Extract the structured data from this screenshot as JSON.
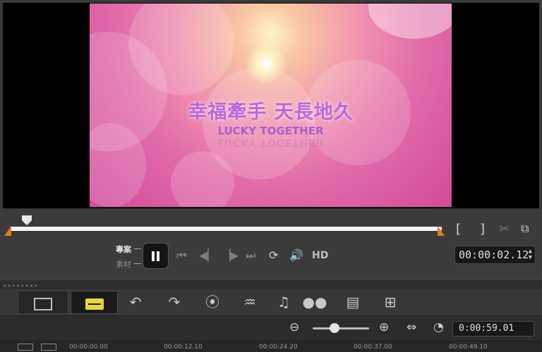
{
  "preview": {
    "title_zh": "幸福牽手 天長地久",
    "title_en": "LUCKY TOGETHER"
  },
  "playback": {
    "mode_project": "專案",
    "mode_clip": "素材",
    "hd_label": "HD",
    "timecode": "00:00:02.12"
  },
  "timeline": {
    "duration": "0:00:59.01",
    "ruler_ticks": [
      "00:00:00.00",
      "00:00:12.10",
      "00:00:24.20",
      "00:00:37.00",
      "00:00:49.10"
    ]
  },
  "icons": {
    "toolbar": [
      "storyboard-view-icon",
      "timeline-view-icon",
      "undo-icon",
      "redo-icon",
      "record-capture-icon",
      "sound-mixer-icon",
      "auto-music-icon",
      "motion-tracking-icon",
      "subtitle-editor-icon",
      "multi-camera-icon"
    ]
  },
  "colors": {
    "accent_orange": "#e07a1e",
    "timeline_icon_yellow": "#e8d63a"
  }
}
